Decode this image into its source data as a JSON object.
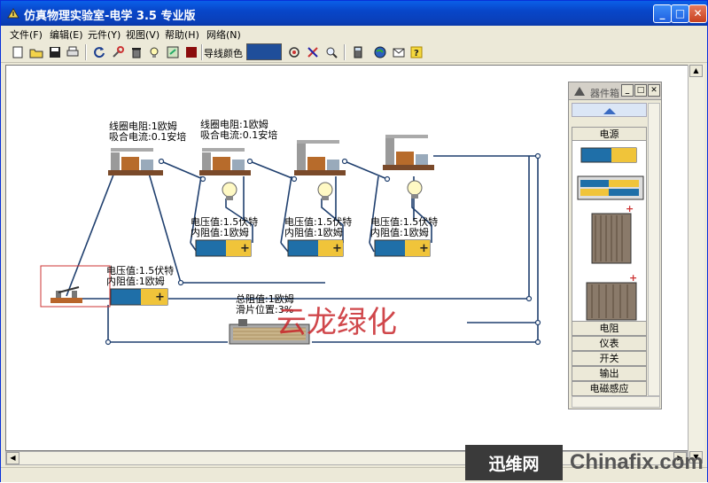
{
  "window": {
    "title": "仿真物理实验室-电学 3.5 专业版",
    "min_label": "_",
    "max_label": "□",
    "close_label": "✕"
  },
  "menu": [
    "文件(F)",
    "编辑(E)",
    "元件(Y)",
    "视图(V)",
    "帮助(H)",
    "网络(N)"
  ],
  "toolbar": {
    "wire_color_label": "导线颜色",
    "wire_color": "#1f4e9a",
    "icons": [
      "new-file-icon",
      "open-file-icon",
      "save-icon",
      "print-icon",
      "refresh-icon",
      "tools-icon",
      "delete-icon",
      "bulb-icon",
      "export-icon",
      "stop-icon",
      "color-swatch",
      "connect-icon",
      "wire-icon",
      "zoom-icon",
      "calculator-icon",
      "globe-icon",
      "mail-icon",
      "help-icon"
    ]
  },
  "canvas": {
    "relay1": {
      "line1": "线圈电阻:1欧姆",
      "line2": "吸合电流:0.1安培"
    },
    "relay2": {
      "line1": "线圈电阻:1欧姆",
      "line2": "吸合电流:0.1安培"
    },
    "battery_a": {
      "line1": "电压值:1.5伏特",
      "line2": "内阻值:1欧姆"
    },
    "battery_b": {
      "line1": "电压值:1.5伏特",
      "line2": "内阻值:1欧姆"
    },
    "battery_c": {
      "line1": "电压值:1.5伏特",
      "line2": "内阻值:1欧姆"
    },
    "battery_main": {
      "line1": "电压值:1.5伏特",
      "line2": "内阻值:1欧姆"
    },
    "rheostat": {
      "line1": "总阻值:1欧姆",
      "line2": "滑片位置:3%"
    },
    "overlay": "云龙绿化"
  },
  "palette": {
    "title": "器件箱",
    "current_category": "电源",
    "categories": [
      "电阻",
      "仪表",
      "开关",
      "输出",
      "电磁感应"
    ]
  },
  "watermark": {
    "badge": "迅维网",
    "text": "Chinafix.com"
  }
}
